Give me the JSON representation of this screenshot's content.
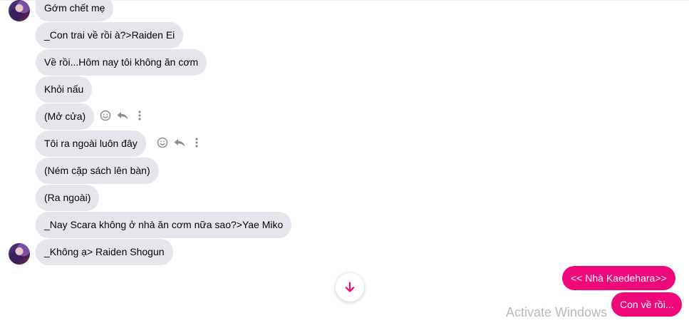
{
  "messages": [
    {
      "text": "Gớm chết mẹ"
    },
    {
      "text": "_Con trai về rồi à?>Raiden Ei"
    },
    {
      "text": "Về rồi...Hôm nay tôi không ăn cơm"
    },
    {
      "text": "Khỏi nấu"
    },
    {
      "text": "(Mở cửa)"
    },
    {
      "text": "Tôi ra ngoài luôn đây"
    },
    {
      "text": "(Ném cặp sách lên bàn)"
    },
    {
      "text": "(Ra ngoài)"
    },
    {
      "text": "_Nay Scara không ở nhà ăn cơm nữa sao?>Yae Miko"
    },
    {
      "text": "_Không ạ> Raiden Shogun"
    }
  ],
  "sent_messages": [
    {
      "text": "<< Nhà Kaedehara>>"
    },
    {
      "text": "Con về rồi..."
    }
  ],
  "watermark": "Activate Windows",
  "colors": {
    "incoming_bubble": "#e4e6eb",
    "outgoing_bubble": "#f0087a",
    "accent": "#f0087a"
  },
  "icons": {
    "react": "smiley-icon",
    "reply": "reply-icon",
    "more": "more-dots-icon",
    "scroll": "arrow-down-icon"
  }
}
